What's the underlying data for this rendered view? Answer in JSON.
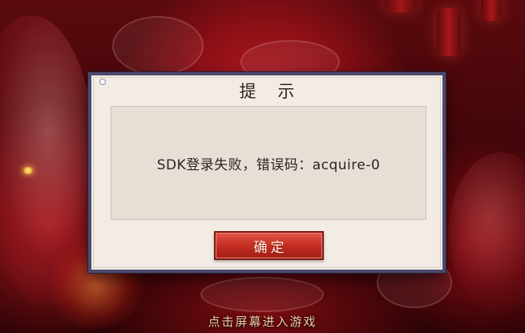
{
  "dialog": {
    "title": "提 示",
    "message": "SDK登录失败，错误码：acquire-0",
    "confirm_label": "确定"
  },
  "footer": {
    "tap_hint": "点击屏幕进入游戏"
  },
  "colors": {
    "dialog_border": "#4d4a6e",
    "dialog_bg": "#f3ece4",
    "button_red": "#c42e22",
    "hint_text": "#e7cfa6"
  }
}
